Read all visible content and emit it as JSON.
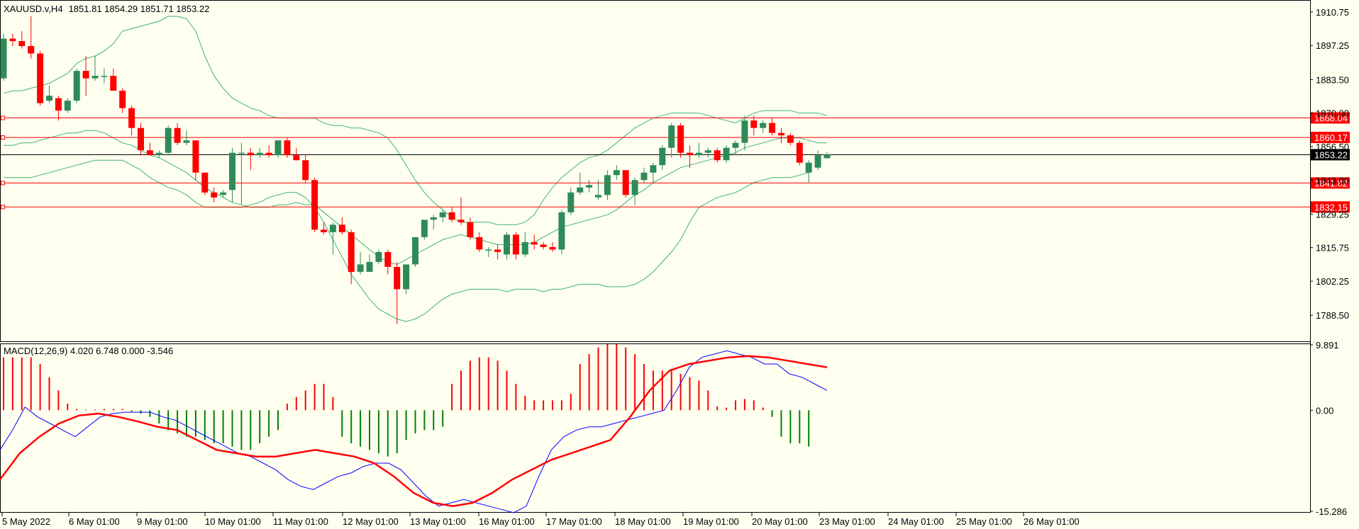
{
  "chart_data": [
    {
      "type": "candlestick",
      "title": "XAUUSD.v,H4",
      "ohlc_label": "1851.81 1854.29 1851.71 1853.22",
      "ylim": [
        1778,
        1915
      ],
      "y_ticks": [
        "1910.75",
        "1897.25",
        "1883.50",
        "1870.00",
        "1856.50",
        "1843.00",
        "1829.25",
        "1815.75",
        "1802.25",
        "1788.50"
      ],
      "x_ticks": [
        "5 May 2022",
        "6 May 01:00",
        "9 May 01:00",
        "10 May 01:00",
        "11 May 01:00",
        "12 May 01:00",
        "13 May 01:00",
        "16 May 01:00",
        "17 May 01:00",
        "18 May 01:00",
        "19 May 01:00",
        "20 May 01:00",
        "23 May 01:00",
        "24 May 01:00",
        "25 May 01:00",
        "26 May 01:00"
      ],
      "horizontal_lines": [
        {
          "price": 1868.04,
          "label": "1868.04",
          "color": "#ff0000"
        },
        {
          "price": 1860.17,
          "label": "1860.17",
          "color": "#ff0000"
        },
        {
          "price": 1841.82,
          "label": "1841.82",
          "color": "#ff0000"
        },
        {
          "price": 1832.15,
          "label": "1832.15",
          "color": "#ff0000"
        }
      ],
      "current_price": {
        "price": 1853.22,
        "label": "1853.22",
        "color": "#000000"
      },
      "candles": [
        {
          "o": 1884,
          "h": 1902,
          "l": 1883,
          "c": 1900
        },
        {
          "o": 1900,
          "h": 1902,
          "l": 1897,
          "c": 1899
        },
        {
          "o": 1899,
          "h": 1903,
          "l": 1896,
          "c": 1897
        },
        {
          "o": 1897,
          "h": 1909,
          "l": 1892,
          "c": 1894
        },
        {
          "o": 1894,
          "h": 1895,
          "l": 1873,
          "c": 1874
        },
        {
          "o": 1875,
          "h": 1881,
          "l": 1874,
          "c": 1877
        },
        {
          "o": 1876,
          "h": 1877,
          "l": 1867,
          "c": 1871
        },
        {
          "o": 1871,
          "h": 1876,
          "l": 1870,
          "c": 1875
        },
        {
          "o": 1875,
          "h": 1888,
          "l": 1874,
          "c": 1887
        },
        {
          "o": 1887,
          "h": 1893,
          "l": 1877,
          "c": 1884
        },
        {
          "o": 1884,
          "h": 1893,
          "l": 1883,
          "c": 1885
        },
        {
          "o": 1885,
          "h": 1888,
          "l": 1882,
          "c": 1885
        },
        {
          "o": 1885,
          "h": 1888,
          "l": 1879,
          "c": 1879
        },
        {
          "o": 1879,
          "h": 1880,
          "l": 1870,
          "c": 1872
        },
        {
          "o": 1872,
          "h": 1873,
          "l": 1861,
          "c": 1864
        },
        {
          "o": 1864,
          "h": 1866,
          "l": 1853,
          "c": 1855
        },
        {
          "o": 1855,
          "h": 1858,
          "l": 1853,
          "c": 1853
        },
        {
          "o": 1853,
          "h": 1855,
          "l": 1852,
          "c": 1854
        },
        {
          "o": 1854,
          "h": 1865,
          "l": 1853,
          "c": 1864
        },
        {
          "o": 1864,
          "h": 1866,
          "l": 1857,
          "c": 1858
        },
        {
          "o": 1858,
          "h": 1863,
          "l": 1857,
          "c": 1859
        },
        {
          "o": 1859,
          "h": 1859,
          "l": 1843,
          "c": 1846
        },
        {
          "o": 1846,
          "h": 1846,
          "l": 1837,
          "c": 1838
        },
        {
          "o": 1838,
          "h": 1840,
          "l": 1834,
          "c": 1836
        },
        {
          "o": 1837,
          "h": 1839,
          "l": 1836,
          "c": 1838
        },
        {
          "o": 1839,
          "h": 1856,
          "l": 1834,
          "c": 1854
        },
        {
          "o": 1854,
          "h": 1858,
          "l": 1833,
          "c": 1854
        },
        {
          "o": 1854,
          "h": 1856,
          "l": 1847,
          "c": 1853
        },
        {
          "o": 1853,
          "h": 1856,
          "l": 1852,
          "c": 1854
        },
        {
          "o": 1854,
          "h": 1857,
          "l": 1852,
          "c": 1853
        },
        {
          "o": 1853,
          "h": 1858,
          "l": 1852,
          "c": 1859
        },
        {
          "o": 1859,
          "h": 1860,
          "l": 1852,
          "c": 1853
        },
        {
          "o": 1853,
          "h": 1856,
          "l": 1851,
          "c": 1851
        },
        {
          "o": 1851,
          "h": 1853,
          "l": 1842,
          "c": 1843
        },
        {
          "o": 1843,
          "h": 1844,
          "l": 1822,
          "c": 1823
        },
        {
          "o": 1823,
          "h": 1826,
          "l": 1821,
          "c": 1822
        },
        {
          "o": 1822,
          "h": 1826,
          "l": 1813,
          "c": 1825
        },
        {
          "o": 1825,
          "h": 1828,
          "l": 1821,
          "c": 1822
        },
        {
          "o": 1822,
          "h": 1823,
          "l": 1801,
          "c": 1806
        },
        {
          "o": 1806,
          "h": 1814,
          "l": 1805,
          "c": 1809
        },
        {
          "o": 1806,
          "h": 1813,
          "l": 1806,
          "c": 1810
        },
        {
          "o": 1810,
          "h": 1815,
          "l": 1809,
          "c": 1814
        },
        {
          "o": 1814,
          "h": 1815,
          "l": 1805,
          "c": 1808
        },
        {
          "o": 1808,
          "h": 1810,
          "l": 1785,
          "c": 1799
        },
        {
          "o": 1799,
          "h": 1809,
          "l": 1797,
          "c": 1809
        },
        {
          "o": 1809,
          "h": 1820,
          "l": 1808,
          "c": 1820
        },
        {
          "o": 1820,
          "h": 1826,
          "l": 1819,
          "c": 1827
        },
        {
          "o": 1827,
          "h": 1829,
          "l": 1823,
          "c": 1828
        },
        {
          "o": 1828,
          "h": 1831,
          "l": 1826,
          "c": 1830
        },
        {
          "o": 1830,
          "h": 1832,
          "l": 1826,
          "c": 1827
        },
        {
          "o": 1827,
          "h": 1836,
          "l": 1825,
          "c": 1826
        },
        {
          "o": 1826,
          "h": 1828,
          "l": 1819,
          "c": 1820
        },
        {
          "o": 1820,
          "h": 1822,
          "l": 1814,
          "c": 1815
        },
        {
          "o": 1815,
          "h": 1816,
          "l": 1812,
          "c": 1815
        },
        {
          "o": 1815,
          "h": 1817,
          "l": 1811,
          "c": 1814
        },
        {
          "o": 1813,
          "h": 1822,
          "l": 1811,
          "c": 1821
        },
        {
          "o": 1821,
          "h": 1822,
          "l": 1811,
          "c": 1813
        },
        {
          "o": 1813,
          "h": 1822,
          "l": 1812,
          "c": 1818
        },
        {
          "o": 1818,
          "h": 1821,
          "l": 1815,
          "c": 1817
        },
        {
          "o": 1817,
          "h": 1818,
          "l": 1815,
          "c": 1816
        },
        {
          "o": 1816,
          "h": 1818,
          "l": 1814,
          "c": 1815
        },
        {
          "o": 1815,
          "h": 1831,
          "l": 1813,
          "c": 1830
        },
        {
          "o": 1830,
          "h": 1840,
          "l": 1829,
          "c": 1838
        },
        {
          "o": 1838,
          "h": 1846,
          "l": 1837,
          "c": 1840
        },
        {
          "o": 1840,
          "h": 1843,
          "l": 1838,
          "c": 1841
        },
        {
          "o": 1836,
          "h": 1843,
          "l": 1835,
          "c": 1837
        },
        {
          "o": 1837,
          "h": 1847,
          "l": 1835,
          "c": 1845
        },
        {
          "o": 1845,
          "h": 1849,
          "l": 1843,
          "c": 1847
        },
        {
          "o": 1847,
          "h": 1847,
          "l": 1836,
          "c": 1837
        },
        {
          "o": 1837,
          "h": 1844,
          "l": 1833,
          "c": 1843
        },
        {
          "o": 1843,
          "h": 1848,
          "l": 1842,
          "c": 1846
        },
        {
          "o": 1846,
          "h": 1850,
          "l": 1842,
          "c": 1849
        },
        {
          "o": 1849,
          "h": 1857,
          "l": 1847,
          "c": 1856
        },
        {
          "o": 1856,
          "h": 1866,
          "l": 1852,
          "c": 1865
        },
        {
          "o": 1865,
          "h": 1866,
          "l": 1852,
          "c": 1854
        },
        {
          "o": 1854,
          "h": 1857,
          "l": 1848,
          "c": 1853
        },
        {
          "o": 1853,
          "h": 1858,
          "l": 1852,
          "c": 1854
        },
        {
          "o": 1854,
          "h": 1856,
          "l": 1852,
          "c": 1855
        },
        {
          "o": 1855,
          "h": 1856,
          "l": 1850,
          "c": 1851
        },
        {
          "o": 1851,
          "h": 1857,
          "l": 1850,
          "c": 1856
        },
        {
          "o": 1856,
          "h": 1859,
          "l": 1853,
          "c": 1858
        },
        {
          "o": 1858,
          "h": 1869,
          "l": 1855,
          "c": 1867
        },
        {
          "o": 1867,
          "h": 1869,
          "l": 1861,
          "c": 1864
        },
        {
          "o": 1864,
          "h": 1867,
          "l": 1862,
          "c": 1866
        },
        {
          "o": 1866,
          "h": 1868,
          "l": 1861,
          "c": 1862
        },
        {
          "o": 1862,
          "h": 1864,
          "l": 1858,
          "c": 1861
        },
        {
          "o": 1861,
          "h": 1862,
          "l": 1857,
          "c": 1858
        },
        {
          "o": 1858,
          "h": 1859,
          "l": 1849,
          "c": 1850
        },
        {
          "o": 1846,
          "h": 1851,
          "l": 1842,
          "c": 1850
        },
        {
          "o": 1848,
          "h": 1855,
          "l": 1847,
          "c": 1853
        },
        {
          "o": 1851.81,
          "h": 1854.29,
          "l": 1851.71,
          "c": 1853.22
        }
      ],
      "bollinger": {
        "upper": [
          1878,
          1879,
          1879,
          1880,
          1881,
          1882,
          1884,
          1886,
          1890,
          1892,
          1893,
          1895,
          1898,
          1903,
          1904,
          1905,
          1906,
          1907,
          1909,
          1909,
          1908,
          1903,
          1893,
          1885,
          1880,
          1876,
          1874,
          1872,
          1871,
          1869,
          1868,
          1868,
          1868,
          1868,
          1868,
          1866,
          1865,
          1865,
          1864,
          1864,
          1863,
          1862,
          1860,
          1855,
          1849,
          1843,
          1838,
          1834,
          1831,
          1828,
          1826,
          1826,
          1826,
          1826,
          1825,
          1825,
          1825,
          1826,
          1829,
          1835,
          1840,
          1844,
          1847,
          1850,
          1852,
          1853,
          1855,
          1858,
          1861,
          1864,
          1866,
          1868,
          1869,
          1870,
          1870,
          1870,
          1870,
          1869,
          1868,
          1867,
          1866,
          1868,
          1870,
          1871,
          1871,
          1871,
          1871,
          1870,
          1870,
          1870,
          1869
        ],
        "middle": [
          1857,
          1857,
          1858,
          1858,
          1859,
          1860,
          1861,
          1862,
          1862,
          1863,
          1863,
          1862,
          1860,
          1858,
          1857,
          1855,
          1853,
          1852,
          1850,
          1848,
          1846,
          1843,
          1840,
          1838,
          1836,
          1834,
          1833,
          1832,
          1832,
          1832,
          1833,
          1833,
          1834,
          1833,
          1833,
          1830,
          1827,
          1824,
          1821,
          1818,
          1815,
          1812,
          1810,
          1809,
          1811,
          1813,
          1815,
          1817,
          1819,
          1820,
          1821,
          1820,
          1819,
          1818,
          1817,
          1817,
          1817,
          1817,
          1818,
          1820,
          1822,
          1824,
          1825,
          1826,
          1827,
          1828,
          1829,
          1831,
          1834,
          1837,
          1839,
          1842,
          1844,
          1846,
          1848,
          1849,
          1850,
          1851,
          1852,
          1853,
          1854,
          1856,
          1857,
          1858,
          1859,
          1860,
          1860,
          1860,
          1859,
          1858,
          1858
        ],
        "lower": [
          1844,
          1844,
          1844,
          1844,
          1845,
          1846,
          1847,
          1848,
          1849,
          1850,
          1851,
          1851,
          1851,
          1851,
          1849,
          1847,
          1844,
          1842,
          1840,
          1839,
          1837,
          1834,
          1832,
          1832,
          1832,
          1832,
          1832,
          1833,
          1834,
          1836,
          1837,
          1838,
          1838,
          1836,
          1832,
          1826,
          1819,
          1812,
          1805,
          1800,
          1795,
          1791,
          1789,
          1787,
          1786,
          1787,
          1789,
          1792,
          1795,
          1797,
          1798,
          1799,
          1799,
          1799,
          1799,
          1798,
          1799,
          1799,
          1799,
          1798,
          1799,
          1799,
          1800,
          1801,
          1801,
          1801,
          1800,
          1800,
          1800,
          1801,
          1803,
          1806,
          1810,
          1814,
          1819,
          1826,
          1832,
          1834,
          1836,
          1837,
          1838,
          1840,
          1842,
          1843,
          1844,
          1844,
          1844,
          1845,
          1846
        ]
      }
    },
    {
      "type": "macd",
      "title": "MACD(12,26,9) 4.020 6.748 0.000 -3.546",
      "ylim": [
        -15.286,
        9.891
      ],
      "y_ticks": [
        "9.891",
        "0.00",
        "-15.286"
      ],
      "histogram": [
        8,
        8,
        8,
        8,
        7,
        5,
        3,
        1,
        0.2,
        0.1,
        0.1,
        0.2,
        0.2,
        0.2,
        -0.2,
        -0.5,
        -1,
        -2,
        -3,
        -3.5,
        -4,
        -4,
        -4.5,
        -5,
        -5,
        -5.5,
        -6,
        -6,
        -5,
        -4,
        -3,
        1,
        2,
        3,
        4,
        4,
        2,
        -4,
        -5,
        -5.5,
        -6,
        -6.5,
        -7,
        -6.5,
        -4.5,
        -3.5,
        -3,
        -3,
        -2.5,
        4,
        6,
        7.5,
        8,
        8,
        7.5,
        6,
        4,
        2.2,
        1.5,
        1.5,
        1.5,
        1.5,
        2.5,
        7,
        8.5,
        9.5,
        10,
        10,
        9.5,
        8.5,
        7,
        6,
        6,
        6,
        5.5,
        5,
        4.5,
        3,
        0.6,
        0.4,
        1.5,
        1.7,
        1.5,
        0.4,
        -1,
        -4,
        -5,
        -5,
        -5.5
      ],
      "macd_line": [
        -6,
        -3,
        0.5,
        -1,
        -2,
        -3,
        -4,
        -2.5,
        -1,
        -0.5,
        -0.3,
        -0.3,
        -0.3,
        -1,
        -1.5,
        -2.5,
        -3.5,
        -4.5,
        -5.5,
        -6.5,
        -7,
        -8,
        -9,
        -10.5,
        -11.5,
        -12,
        -11,
        -10,
        -9.5,
        -8.5,
        -8,
        -8,
        -9,
        -11,
        -13,
        -14.5,
        -14,
        -13.5,
        -14,
        -14.5,
        -15,
        -15.5,
        -14.5,
        -10,
        -6,
        -4,
        -3,
        -2.5,
        -2.5,
        -2,
        -1.5,
        -1,
        -0.5,
        0,
        3,
        6.5,
        8,
        8.5,
        9,
        8.5,
        8,
        7,
        7,
        5.5,
        5,
        4,
        3
      ],
      "signal_line": [
        -10.5,
        -6.5,
        -4,
        -2,
        -0.8,
        -0.5,
        -1,
        -1.7,
        -2.5,
        -3,
        -4.5,
        -6,
        -6.5,
        -7,
        -7,
        -6.5,
        -6,
        -6.5,
        -7,
        -8,
        -10,
        -12.5,
        -14,
        -14.5,
        -14,
        -12.5,
        -10.5,
        -9,
        -7.5,
        -6.5,
        -5.5,
        -4.5,
        -1,
        3,
        6,
        7,
        7.5,
        8,
        8.2,
        8,
        7.5,
        7,
        6.5
      ]
    }
  ],
  "colors": {
    "background": "#fffff0",
    "bull_candle": "#2e8b57",
    "bear_candle": "#ff0000",
    "bollinger": "#3cb371",
    "level_line": "#ff0000",
    "price_line": "#000000",
    "macd_line": "#0000ff",
    "signal_line": "#ff0000",
    "hist_positive": "#ff0000",
    "hist_negative": "#008000"
  }
}
